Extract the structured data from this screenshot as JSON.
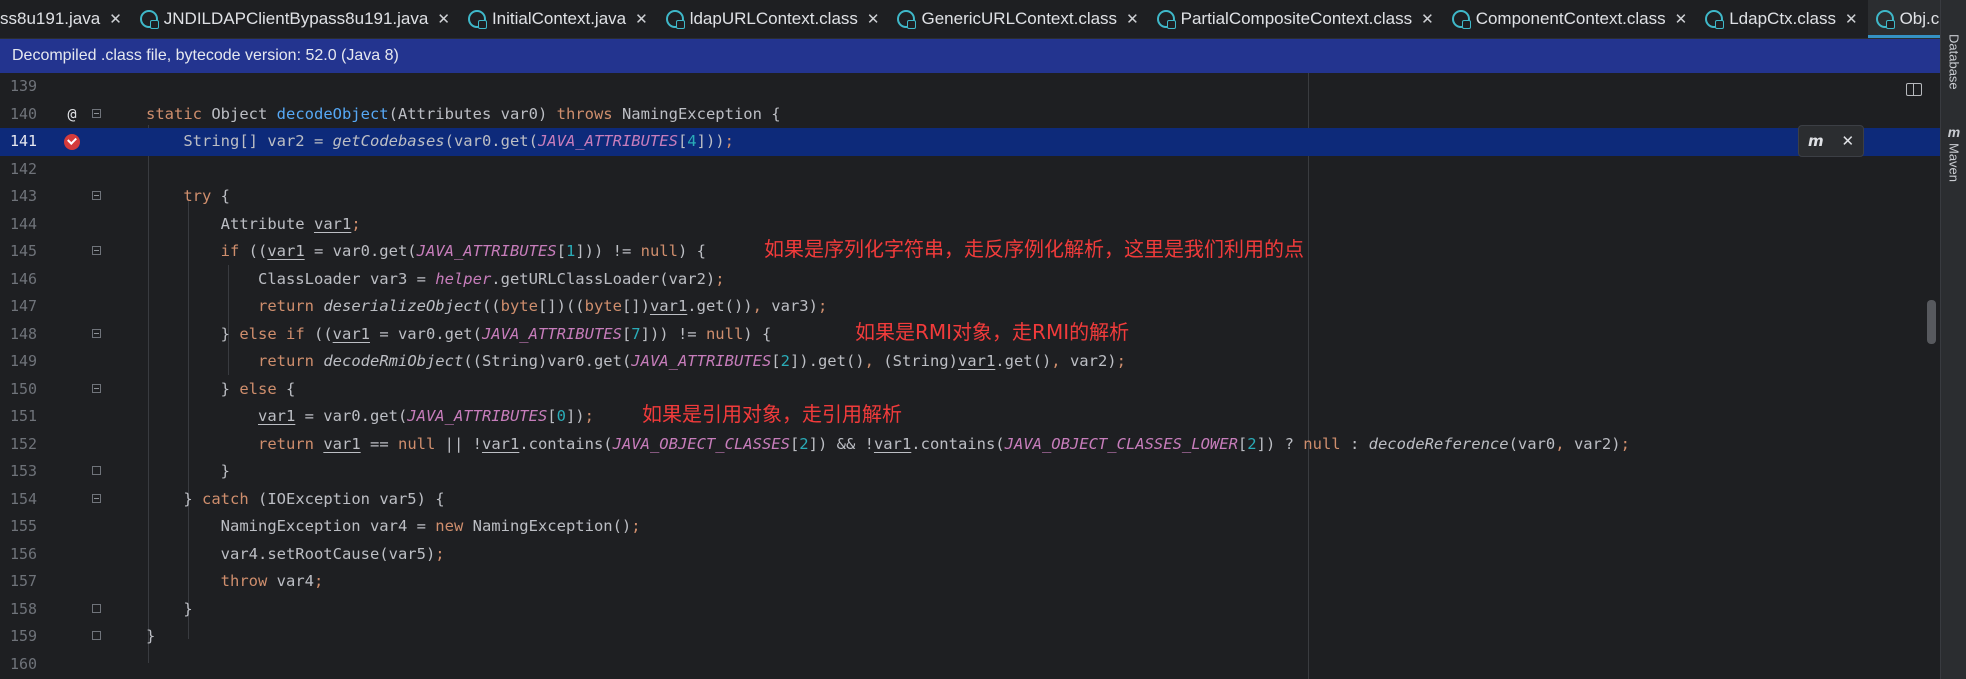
{
  "tabs": [
    {
      "label": "ss8u191.java",
      "icon": "none",
      "active": false
    },
    {
      "label": "JNDILDAPClientBypass8u191.java",
      "icon": "class-icon",
      "active": false
    },
    {
      "label": "InitialContext.java",
      "icon": "class-icon",
      "active": false
    },
    {
      "label": "ldapURLContext.class",
      "icon": "class-icon",
      "active": false
    },
    {
      "label": "GenericURLContext.class",
      "icon": "class-icon",
      "active": false
    },
    {
      "label": "PartialCompositeContext.class",
      "icon": "class-icon",
      "active": false
    },
    {
      "label": "ComponentContext.class",
      "icon": "class-icon",
      "active": false
    },
    {
      "label": "LdapCtx.class",
      "icon": "class-icon",
      "active": false
    },
    {
      "label": "Obj.class",
      "icon": "class-icon",
      "active": true
    }
  ],
  "tab_close_glyph": "✕",
  "tab_overflow_glyph": "⌵",
  "banner": {
    "text": "Decompiled .class file, bytecode version: 52.0 (Java 8)"
  },
  "tool_windows": {
    "database": "Database",
    "maven": "Maven",
    "maven_icon_text": "m"
  },
  "gutter": {
    "at_marker": "@",
    "highlighted_line": "141"
  },
  "popup": {
    "icon_text": "m",
    "close": "✕"
  },
  "line_numbers": [
    "139",
    "140",
    "141",
    "142",
    "143",
    "144",
    "145",
    "146",
    "147",
    "148",
    "149",
    "150",
    "151",
    "152",
    "153",
    "154",
    "155",
    "156",
    "157",
    "158",
    "159",
    "160"
  ],
  "annotations": {
    "serialized": "如果是序列化字符串，走反序例化解析，这里是我们利用的点",
    "rmi": "如果是RMI对象，走RMI的解析",
    "reference": "如果是引用对象，走引用解析"
  },
  "colors": {
    "editor_bg": "#1e1f22",
    "banner_bg": "#23348f",
    "highlight_line_bg": "#0d2a7a",
    "keyword": "#cf8e6d",
    "method": "#56a8f5",
    "constant": "#c77dbb",
    "number": "#2aacb8",
    "annotation_text": "#f23b3b",
    "active_tab_underline": "#3592c4"
  }
}
